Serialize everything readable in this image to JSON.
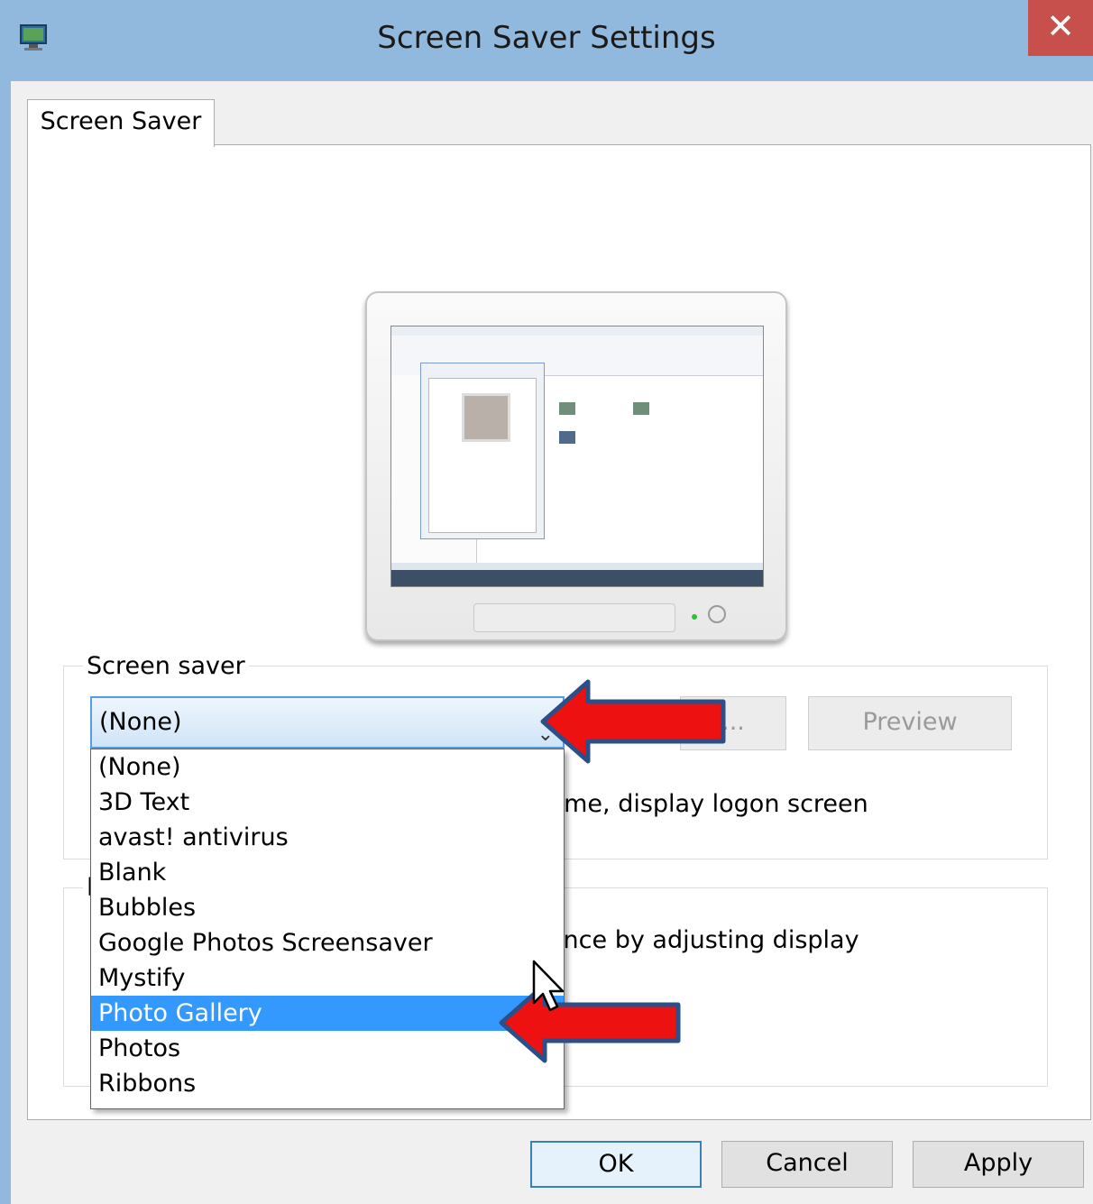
{
  "window": {
    "title": "Screen Saver Settings",
    "close_glyph": "✕"
  },
  "tabs": [
    {
      "label": "Screen Saver"
    }
  ],
  "screen_saver_group": {
    "label": "Screen saver",
    "selected_value": "(None)",
    "settings_label": "...",
    "preview_label": "Preview",
    "resume_text": "ume, display logon screen"
  },
  "power_group": {
    "label": "l",
    "text": "ance by adjusting display"
  },
  "dropdown": {
    "items": [
      {
        "label": "(None)"
      },
      {
        "label": "3D Text"
      },
      {
        "label": "avast! antivirus"
      },
      {
        "label": "Blank"
      },
      {
        "label": "Bubbles"
      },
      {
        "label": "Google Photos Screensaver"
      },
      {
        "label": "Mystify"
      },
      {
        "label": "Photo Gallery"
      },
      {
        "label": "Photos"
      },
      {
        "label": "Ribbons"
      }
    ],
    "selected_label": "Photo Gallery"
  },
  "footer": {
    "ok_label": "OK",
    "cancel_label": "Cancel",
    "apply_label": "Apply"
  },
  "colors": {
    "titlebar": "#91b8dd",
    "close_button": "#c7504d",
    "selection": "#3399ff",
    "annotation_arrow": "#ee1111"
  },
  "icons": [
    "display-settings-icon",
    "close-icon",
    "chevron-down-icon",
    "red-arrow-icon",
    "mouse-pointer-icon"
  ]
}
